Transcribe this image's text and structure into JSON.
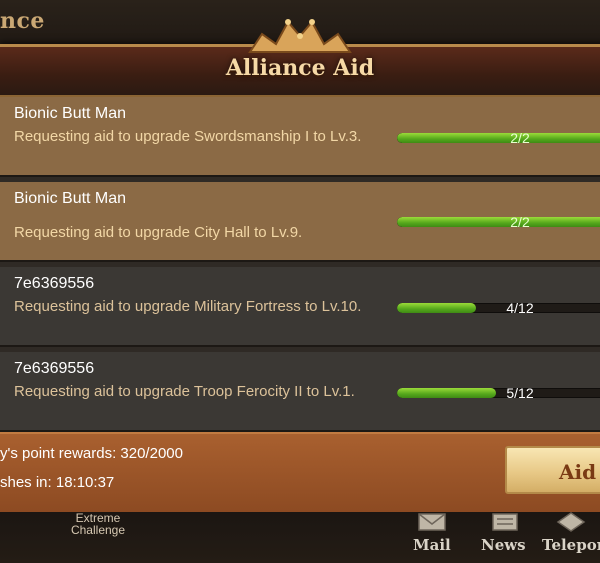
{
  "background": {
    "partial_title": "nce"
  },
  "panel": {
    "title": "Alliance Aid"
  },
  "requests": [
    {
      "name": "Bionic Butt Man",
      "description": "Requesting aid to upgrade Swordsmanship I to Lv.3.",
      "current": 2,
      "total": 2,
      "progress_text": "2/2"
    },
    {
      "name": "Bionic Butt Man",
      "description": "Requesting aid to upgrade City Hall to Lv.9.",
      "current": 2,
      "total": 2,
      "progress_text": "2/2"
    },
    {
      "name": "7e6369556",
      "description": "Requesting aid to upgrade Military Fortress to Lv.10.",
      "current": 4,
      "total": 12,
      "progress_text": "4/12"
    },
    {
      "name": "7e6369556",
      "description": "Requesting aid to upgrade Troop Ferocity II to Lv.1.",
      "current": 5,
      "total": 12,
      "progress_text": "5/12"
    }
  ],
  "footer": {
    "rewards_text": "y's point rewards: 320/2000",
    "finish_text": "shes in: 18:10:37",
    "aid_button": "Aid"
  },
  "bottom_nav": {
    "extreme_challenge": "Extreme Challenge",
    "mail": "Mail",
    "news": "News",
    "teleport": "Telepor"
  },
  "colors": {
    "bar_green": "#6cbf25",
    "row_gold": "#8b6a45",
    "row_dark": "#3b3834",
    "footer_orange": "#a9602f"
  }
}
